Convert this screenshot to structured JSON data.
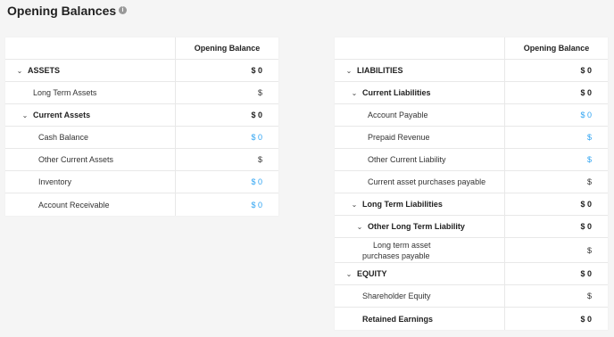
{
  "page": {
    "title": "Opening Balances",
    "info_icon": "info-icon"
  },
  "assets": {
    "header": "Opening Balance",
    "rows": [
      {
        "label": "ASSETS",
        "value": "$ 0"
      },
      {
        "label": "Long Term Assets",
        "value": "$"
      },
      {
        "label": "Current Assets",
        "value": "$ 0"
      },
      {
        "label": "Cash Balance",
        "value": "$ 0"
      },
      {
        "label": "Other Current Assets",
        "value": "$"
      },
      {
        "label": "Inventory",
        "value": "$ 0"
      },
      {
        "label": "Account Receivable",
        "value": "$ 0"
      }
    ]
  },
  "liabilities": {
    "header": "Opening Balance",
    "rows": [
      {
        "label": "LIABILITIES",
        "value": "$ 0"
      },
      {
        "label": "Current Liabilities",
        "value": "$ 0"
      },
      {
        "label": "Account Payable",
        "value": "$ 0"
      },
      {
        "label": "Prepaid Revenue",
        "value": "$"
      },
      {
        "label": "Other Current Liability",
        "value": "$"
      },
      {
        "label": "Current asset purchases payable",
        "value": "$"
      },
      {
        "label": "Long Term Liabilities",
        "value": "$ 0"
      },
      {
        "label": "Other Long Term Liability",
        "value": "$ 0"
      },
      {
        "label": "Long term asset purchases payable",
        "value": "$"
      },
      {
        "label": "EQUITY",
        "value": "$ 0"
      },
      {
        "label": "Shareholder Equity",
        "value": "$"
      },
      {
        "label": "Retained Earnings",
        "value": "$ 0"
      }
    ]
  },
  "colors": {
    "link": "#2ea3f2",
    "text": "#333333",
    "border": "#e8e8e8"
  }
}
